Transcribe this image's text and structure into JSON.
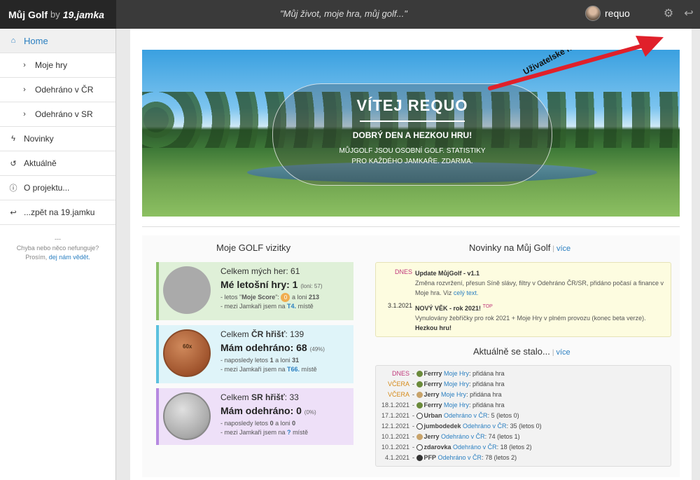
{
  "header": {
    "brand_main": "Můj Golf",
    "brand_by": "by",
    "brand_sub": "19.jamka",
    "tagline": "\"Můj život, moje hra, můj golf...\"",
    "username": "requo",
    "icons": [
      "gear-icon",
      "reply-icon"
    ]
  },
  "sidebar": {
    "items": [
      {
        "label": "Home",
        "icon": "home-icon"
      },
      {
        "label": "Moje hry",
        "icon": "chevron-right-icon"
      },
      {
        "label": "Odehráno v ČR",
        "icon": "chevron-right-icon"
      },
      {
        "label": "Odehráno v SR",
        "icon": "chevron-right-icon"
      },
      {
        "label": "Novinky",
        "icon": "bolt-icon"
      },
      {
        "label": "Aktuálně",
        "icon": "history-icon"
      },
      {
        "label": "O projektu...",
        "icon": "info-icon"
      },
      {
        "label": "...zpět na 19.jamku",
        "icon": "reply-icon"
      }
    ],
    "help_dashes": "---",
    "help_text": "Chyba nebo něco nefunguje?",
    "help_text2": "Prosím,",
    "help_link": "dej nám vědět."
  },
  "hero": {
    "title": "VÍTEJ REQUO",
    "subtitle": "DOBRÝ DEN A HEZKOU HRU!",
    "text1": "MŮJGOLF JSOU OSOBNÍ GOLF. STATISTIKY",
    "text2": "PRO KAŽDÉHO JAMKAŘE. ZDARMA.",
    "annotation": "Uživatelské nastavení"
  },
  "vizitky": {
    "heading": "Moje GOLF vizitky",
    "cards": [
      {
        "l1_a": "Celkem mých her: ",
        "l1_b": "61",
        "l2": "Mé letošní hry: 1",
        "l2_small": "(loni: 57)",
        "l3_a": "- letos \"",
        "l3_b": "Moje Score",
        "l3_c": "\":",
        "badge": "0",
        "l3_d": "a loni",
        "l3_e": "213",
        "l4_a": "- mezi Jamkaři jsem na",
        "l4_b": "T4.",
        "l4_c": "místě"
      },
      {
        "l1_a": "Celkem ",
        "l1_bold": "ČR hřišť",
        "l1_b": ": 139",
        "l2": "Mám odehráno: 68",
        "l2_small": "(49%)",
        "l3_a": "- naposledy letos",
        "l3_b": "1",
        "l3_c": "a loni",
        "l3_d": "31",
        "l4_a": "- mezi Jamkaři jsem na",
        "l4_b": "T66.",
        "l4_c": "místě",
        "medal_text": "60x"
      },
      {
        "l1_a": "Celkem ",
        "l1_bold": "SR hřišť",
        "l1_b": ": 33",
        "l2": "Mám odehráno: 0",
        "l2_small": "(0%)",
        "l3_a": "- naposledy letos",
        "l3_b": "0",
        "l3_c": "a loni",
        "l3_d": "0",
        "l4_a": "- mezi Jamkaři jsem na",
        "l4_b": "?",
        "l4_c": "místě"
      }
    ]
  },
  "news": {
    "heading": "Novinky na Můj Golf",
    "more": "více",
    "items": [
      {
        "date": "DNES",
        "title": "Update MůjGolf - v1.1",
        "text": "Změna rozvržení, přesun Síně slávy, filtry v Odehráno ČR/SR, přidáno počasí a finance v Moje hra. Viz",
        "link": "celý text."
      },
      {
        "date": "3.1.2021",
        "title": "NOVÝ VĚK - rok 2021!",
        "tag": "TOP",
        "text": "Vynulovány žebříčky pro rok 2021 + Moje Hry v plném provozu (konec beta verze).",
        "bold_end": "Hezkou hru!"
      }
    ]
  },
  "activity": {
    "heading": "Aktuálně se stalo...",
    "more": "více",
    "rows": [
      {
        "date": "DNES",
        "user": "Ferrry",
        "link": "Moje Hry",
        "rest": ": přidána hra"
      },
      {
        "date": "VČERA",
        "user": "Ferrry",
        "link": "Moje Hry",
        "rest": ": přidána hra"
      },
      {
        "date": "VČERA",
        "user": "Jerry",
        "link": "Moje Hry",
        "rest": ": přidána hra"
      },
      {
        "date": "18.1.2021",
        "user": "Ferrry",
        "link": "Moje Hry",
        "rest": ": přidána hra"
      },
      {
        "date": "17.1.2021",
        "user": "Urban",
        "link": "Odehráno v ČR",
        "rest": ": 5 (letos 0)"
      },
      {
        "date": "12.1.2021",
        "user": "jumbodedek",
        "link": "Odehráno v ČR",
        "rest": ": 35 (letos 0)"
      },
      {
        "date": "10.1.2021",
        "user": "Jerry",
        "link": "Odehráno v ČR",
        "rest": ": 74 (letos 1)"
      },
      {
        "date": "10.1.2021",
        "user": "zdarovka",
        "link": "Odehráno v ČR",
        "rest": ": 18 (letos 2)"
      },
      {
        "date": "4.1.2021",
        "user": "PFP",
        "link": "Odehráno v ČR",
        "rest": ": 78 (letos 2)"
      }
    ]
  }
}
